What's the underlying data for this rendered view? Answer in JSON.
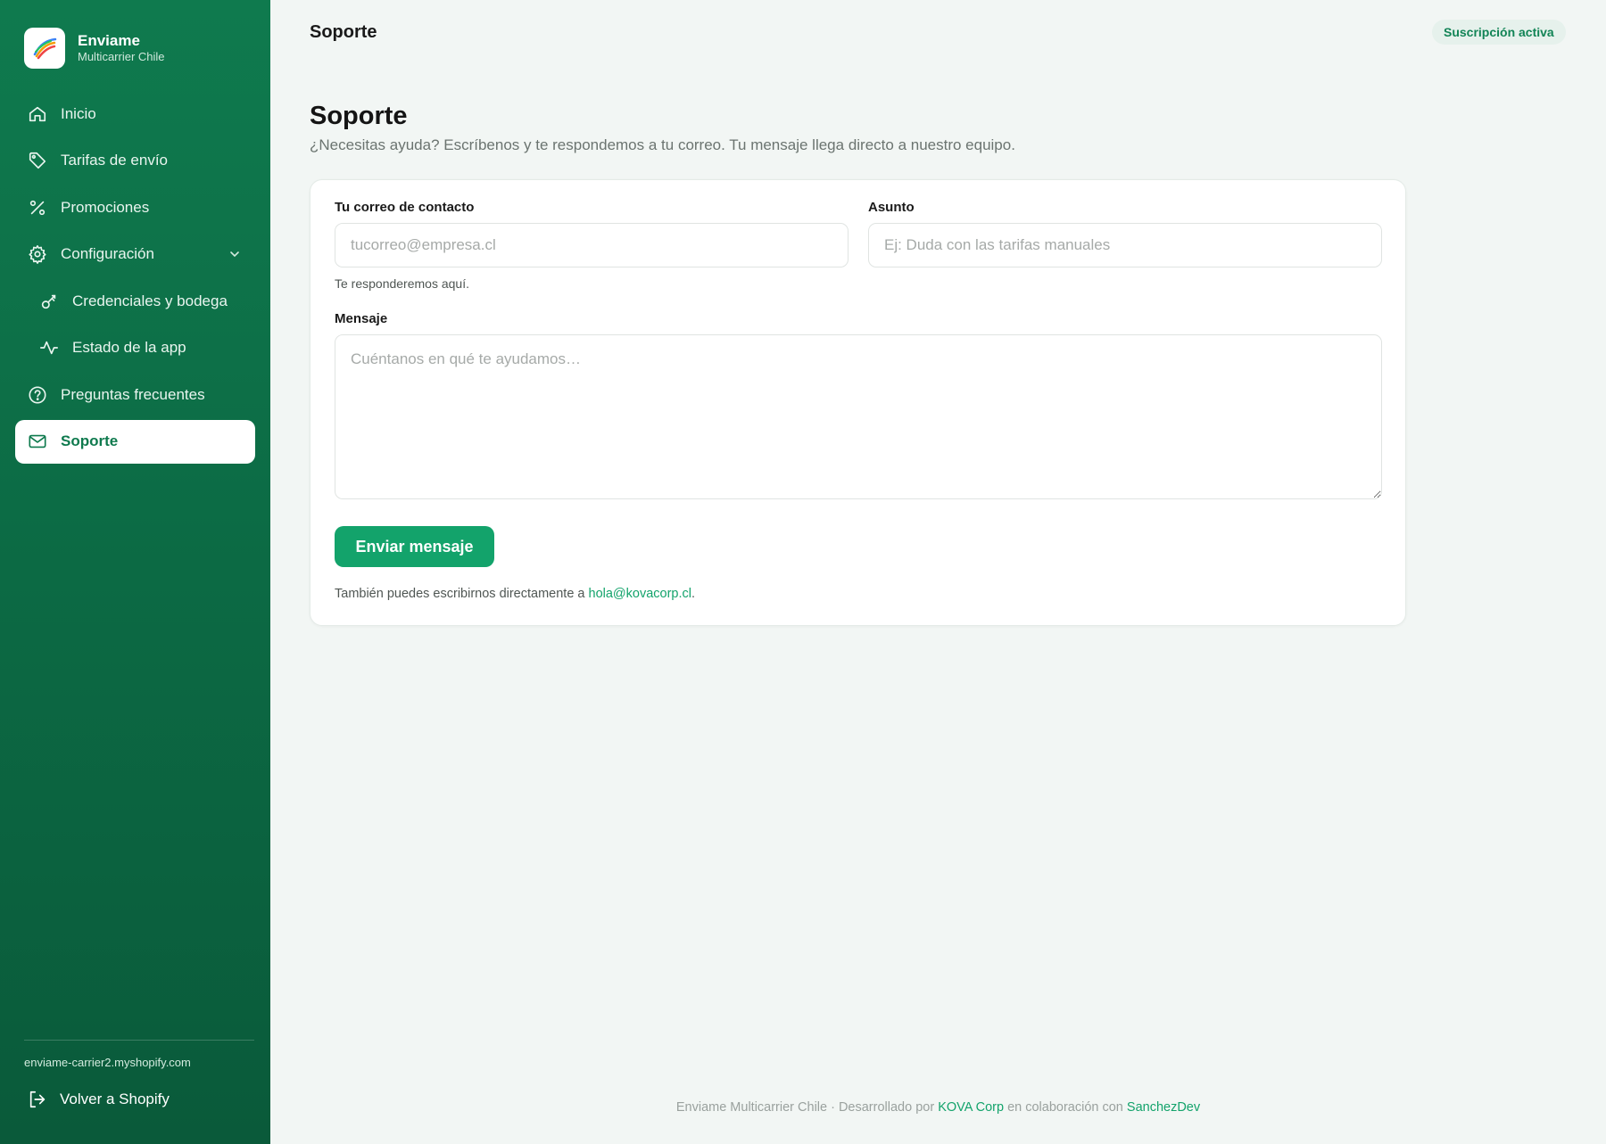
{
  "brand": {
    "name": "Enviame",
    "subtitle": "Multicarrier Chile"
  },
  "sidebar": {
    "items": [
      {
        "label": "Inicio",
        "icon": "home-icon"
      },
      {
        "label": "Tarifas de envío",
        "icon": "tag-icon"
      },
      {
        "label": "Promociones",
        "icon": "percent-icon"
      },
      {
        "label": "Configuración",
        "icon": "gear-icon"
      },
      {
        "label": "Credenciales y bodega",
        "icon": "key-icon"
      },
      {
        "label": "Estado de la app",
        "icon": "activity-icon"
      },
      {
        "label": "Preguntas frecuentes",
        "icon": "help-circle-icon"
      },
      {
        "label": "Soporte",
        "icon": "mail-icon",
        "active": true
      }
    ],
    "shop_domain": "enviame-carrier2.myshopify.com",
    "back_label": "Volver a Shopify"
  },
  "header": {
    "title": "Soporte",
    "badge": "Suscripción activa"
  },
  "page": {
    "title": "Soporte",
    "description": "¿Necesitas ayuda? Escríbenos y te respondemos a tu correo. Tu mensaje llega directo a nuestro equipo."
  },
  "form": {
    "email_label": "Tu correo de contacto",
    "email_placeholder": "tucorreo@empresa.cl",
    "email_value": "",
    "email_hint": "Te responderemos aquí.",
    "subject_label": "Asunto",
    "subject_placeholder": "Ej: Duda con las tarifas manuales",
    "subject_value": "",
    "message_label": "Mensaje",
    "message_placeholder": "Cuéntanos en qué te ayudamos…",
    "message_value": "",
    "submit_label": "Enviar mensaje",
    "alt_prefix": "También puedes escribirnos directamente a ",
    "alt_email": "hola@kovacorp.cl",
    "alt_suffix": "."
  },
  "footer": {
    "prefix": "Enviame Multicarrier Chile · Desarrollado por ",
    "dev_link": "KOVA Corp",
    "middle": " en colaboración con ",
    "collab_link": "SanchezDev"
  },
  "colors": {
    "sidebar": "#0f7a4e",
    "accent": "#13a36b",
    "background": "#f2f6f4"
  }
}
